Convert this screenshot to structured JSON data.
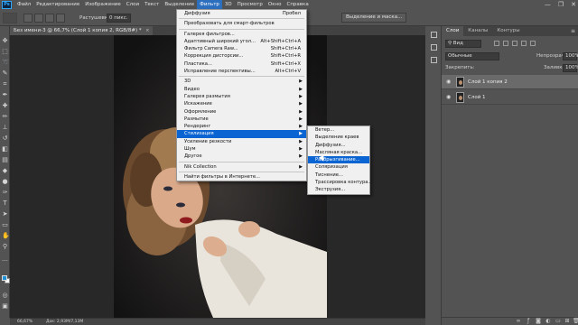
{
  "app": {
    "logo": "Ps"
  },
  "menubar": {
    "items": [
      "Файл",
      "Редактирование",
      "Изображение",
      "Слои",
      "Текст",
      "Выделение",
      "Фильтр",
      "3D",
      "Просмотр",
      "Окно",
      "Справка"
    ],
    "active_index": 6,
    "window_controls": {
      "minimize": "—",
      "restore": "❐",
      "close": "✕"
    }
  },
  "options": {
    "feather_label": "Растушевка:",
    "feather_value": "0 пикс.",
    "select_mask_label": "Выделение и маска..."
  },
  "document": {
    "tab_title": "Без имени-3 @ 66,7% (Слой 1 копия 2, RGB/8#) *",
    "close": "×"
  },
  "status": {
    "zoom": "66,67%",
    "doc_size": "Док: 2,93М/7,13М"
  },
  "filter_menu": {
    "items": [
      {
        "label": "Диффузия",
        "shortcut": "Пробел",
        "submenu": false
      },
      {
        "sep": true
      },
      {
        "label": "Преобразовать для смарт-фильтров",
        "shortcut": "",
        "submenu": false
      },
      {
        "sep": true
      },
      {
        "label": "Галерея фильтров...",
        "shortcut": "",
        "submenu": false
      },
      {
        "label": "Адаптивный широкий угол...",
        "shortcut": "Alt+Shift+Ctrl+A",
        "submenu": false
      },
      {
        "label": "Фильтр Camera Raw...",
        "shortcut": "Shift+Ctrl+A",
        "submenu": false
      },
      {
        "label": "Коррекция дисторсии...",
        "shortcut": "Shift+Ctrl+R",
        "submenu": false
      },
      {
        "label": "Пластика...",
        "shortcut": "Shift+Ctrl+X",
        "submenu": false
      },
      {
        "label": "Исправление перспективы...",
        "shortcut": "Alt+Ctrl+V",
        "submenu": false
      },
      {
        "sep": true
      },
      {
        "label": "3D",
        "shortcut": "",
        "submenu": true
      },
      {
        "label": "Видео",
        "shortcut": "",
        "submenu": true
      },
      {
        "label": "Галерея размытия",
        "shortcut": "",
        "submenu": true
      },
      {
        "label": "Искажение",
        "shortcut": "",
        "submenu": true
      },
      {
        "label": "Оформление",
        "shortcut": "",
        "submenu": true
      },
      {
        "label": "Размытие",
        "shortcut": "",
        "submenu": true
      },
      {
        "label": "Рендеринг",
        "shortcut": "",
        "submenu": true
      },
      {
        "label": "Стилизация",
        "shortcut": "",
        "submenu": true,
        "highlighted": true
      },
      {
        "label": "Усиление резкости",
        "shortcut": "",
        "submenu": true
      },
      {
        "label": "Шум",
        "shortcut": "",
        "submenu": true
      },
      {
        "label": "Другое",
        "shortcut": "",
        "submenu": true
      },
      {
        "sep": true
      },
      {
        "label": "Nik Collection",
        "shortcut": "",
        "submenu": true
      },
      {
        "sep": true
      },
      {
        "label": "Найти фильтры в Интернете...",
        "shortcut": "",
        "submenu": false
      }
    ]
  },
  "stylize_submenu": {
    "items": [
      {
        "label": "Ветер..."
      },
      {
        "label": "Выделение краев"
      },
      {
        "label": "Диффузия..."
      },
      {
        "label": "Масляная краска..."
      },
      {
        "label": "Разбрызгивание...",
        "highlighted": true
      },
      {
        "label": "Соляризация"
      },
      {
        "label": "Тиснение..."
      },
      {
        "label": "Трассировка контура..."
      },
      {
        "label": "Экструзия..."
      }
    ]
  },
  "layers_panel": {
    "tabs": [
      "Слои",
      "Каналы",
      "Контуры"
    ],
    "active_tab": 0,
    "filter_kind": "Вид",
    "blend_mode": "Обычные",
    "opacity_label": "Непрозрачность:",
    "opacity_value": "100%",
    "lock_label": "Закрепить:",
    "fill_label": "Заливка:",
    "fill_value": "100%",
    "layers": [
      {
        "name": "Слой 1 копия 2",
        "selected": true
      },
      {
        "name": "Слой 1",
        "selected": false
      }
    ]
  },
  "colors": {
    "menu_highlight": "#0a64d2",
    "foreground": "#1e90d6",
    "background": "#ffffff"
  }
}
